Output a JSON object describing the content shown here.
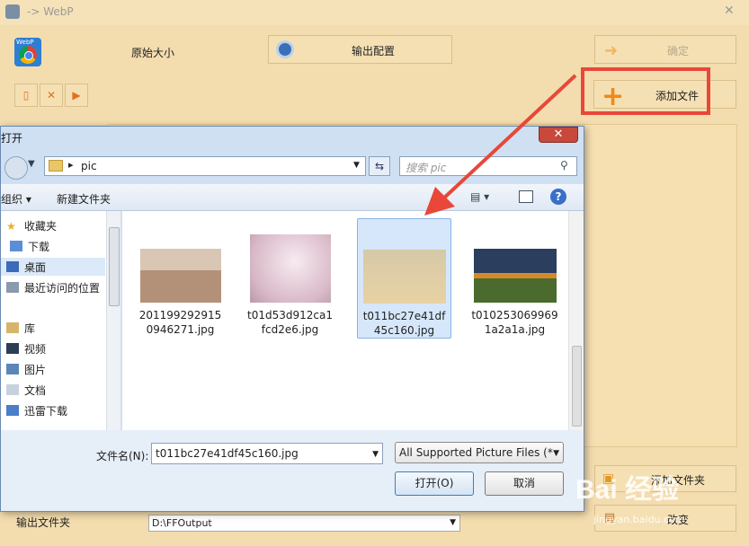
{
  "app": {
    "title": "-> WebP",
    "close_glyph": "✕",
    "logo_text": "WebP",
    "original_size_label": "原始大小",
    "output_config_label": "输出配置",
    "confirm_label": "确定",
    "add_file_label": "添加文件",
    "add_folder_label": "添加文件夹",
    "change_label": "改变",
    "output_folder_label": "输出文件夹",
    "output_folder_value": "D:\\FFOutput",
    "icons": [
      "remove-file-icon",
      "clear-list-icon",
      "play-icon",
      "gear-icon",
      "arrow-right-icon",
      "plus-icon",
      "folder-plus-icon",
      "change-icon"
    ]
  },
  "dialog": {
    "title": "打开",
    "close_glyph": "✕",
    "address_path": "pic",
    "search_placeholder": "搜索 pic",
    "toolbar": {
      "organize": "组织 ▾",
      "new_folder": "新建文件夹"
    },
    "nav": {
      "favorites": "收藏夹",
      "downloads": "下载",
      "desktop": "桌面",
      "recent": "最近访问的位置",
      "libraries": "库",
      "videos": "视频",
      "pictures": "图片",
      "documents": "文档",
      "xunlei": "迅雷下载"
    },
    "files": [
      {
        "name": "2011992929150946271.jpg",
        "selected": false
      },
      {
        "name": "t01d53d912ca1fcd2e6.jpg",
        "selected": false
      },
      {
        "name": "t011bc27e41df45c160.jpg",
        "selected": true
      },
      {
        "name": "t0102530699691a2a1a.jpg",
        "selected": false
      }
    ],
    "file_name_label": "文件名(N):",
    "file_name_value": "t011bc27e41df45c160.jpg",
    "file_type_value": "All Supported Picture Files (*",
    "open_label": "打开(O)",
    "cancel_label": "取消"
  },
  "watermark": {
    "logo": "Bai 经验",
    "url": "jingyan.baidu.com"
  },
  "colors": {
    "app_bg": "#f3dcae",
    "highlight_red": "#e8473a",
    "dialog_bg": "#cfe0f3",
    "selection": "#d6e7fb"
  }
}
